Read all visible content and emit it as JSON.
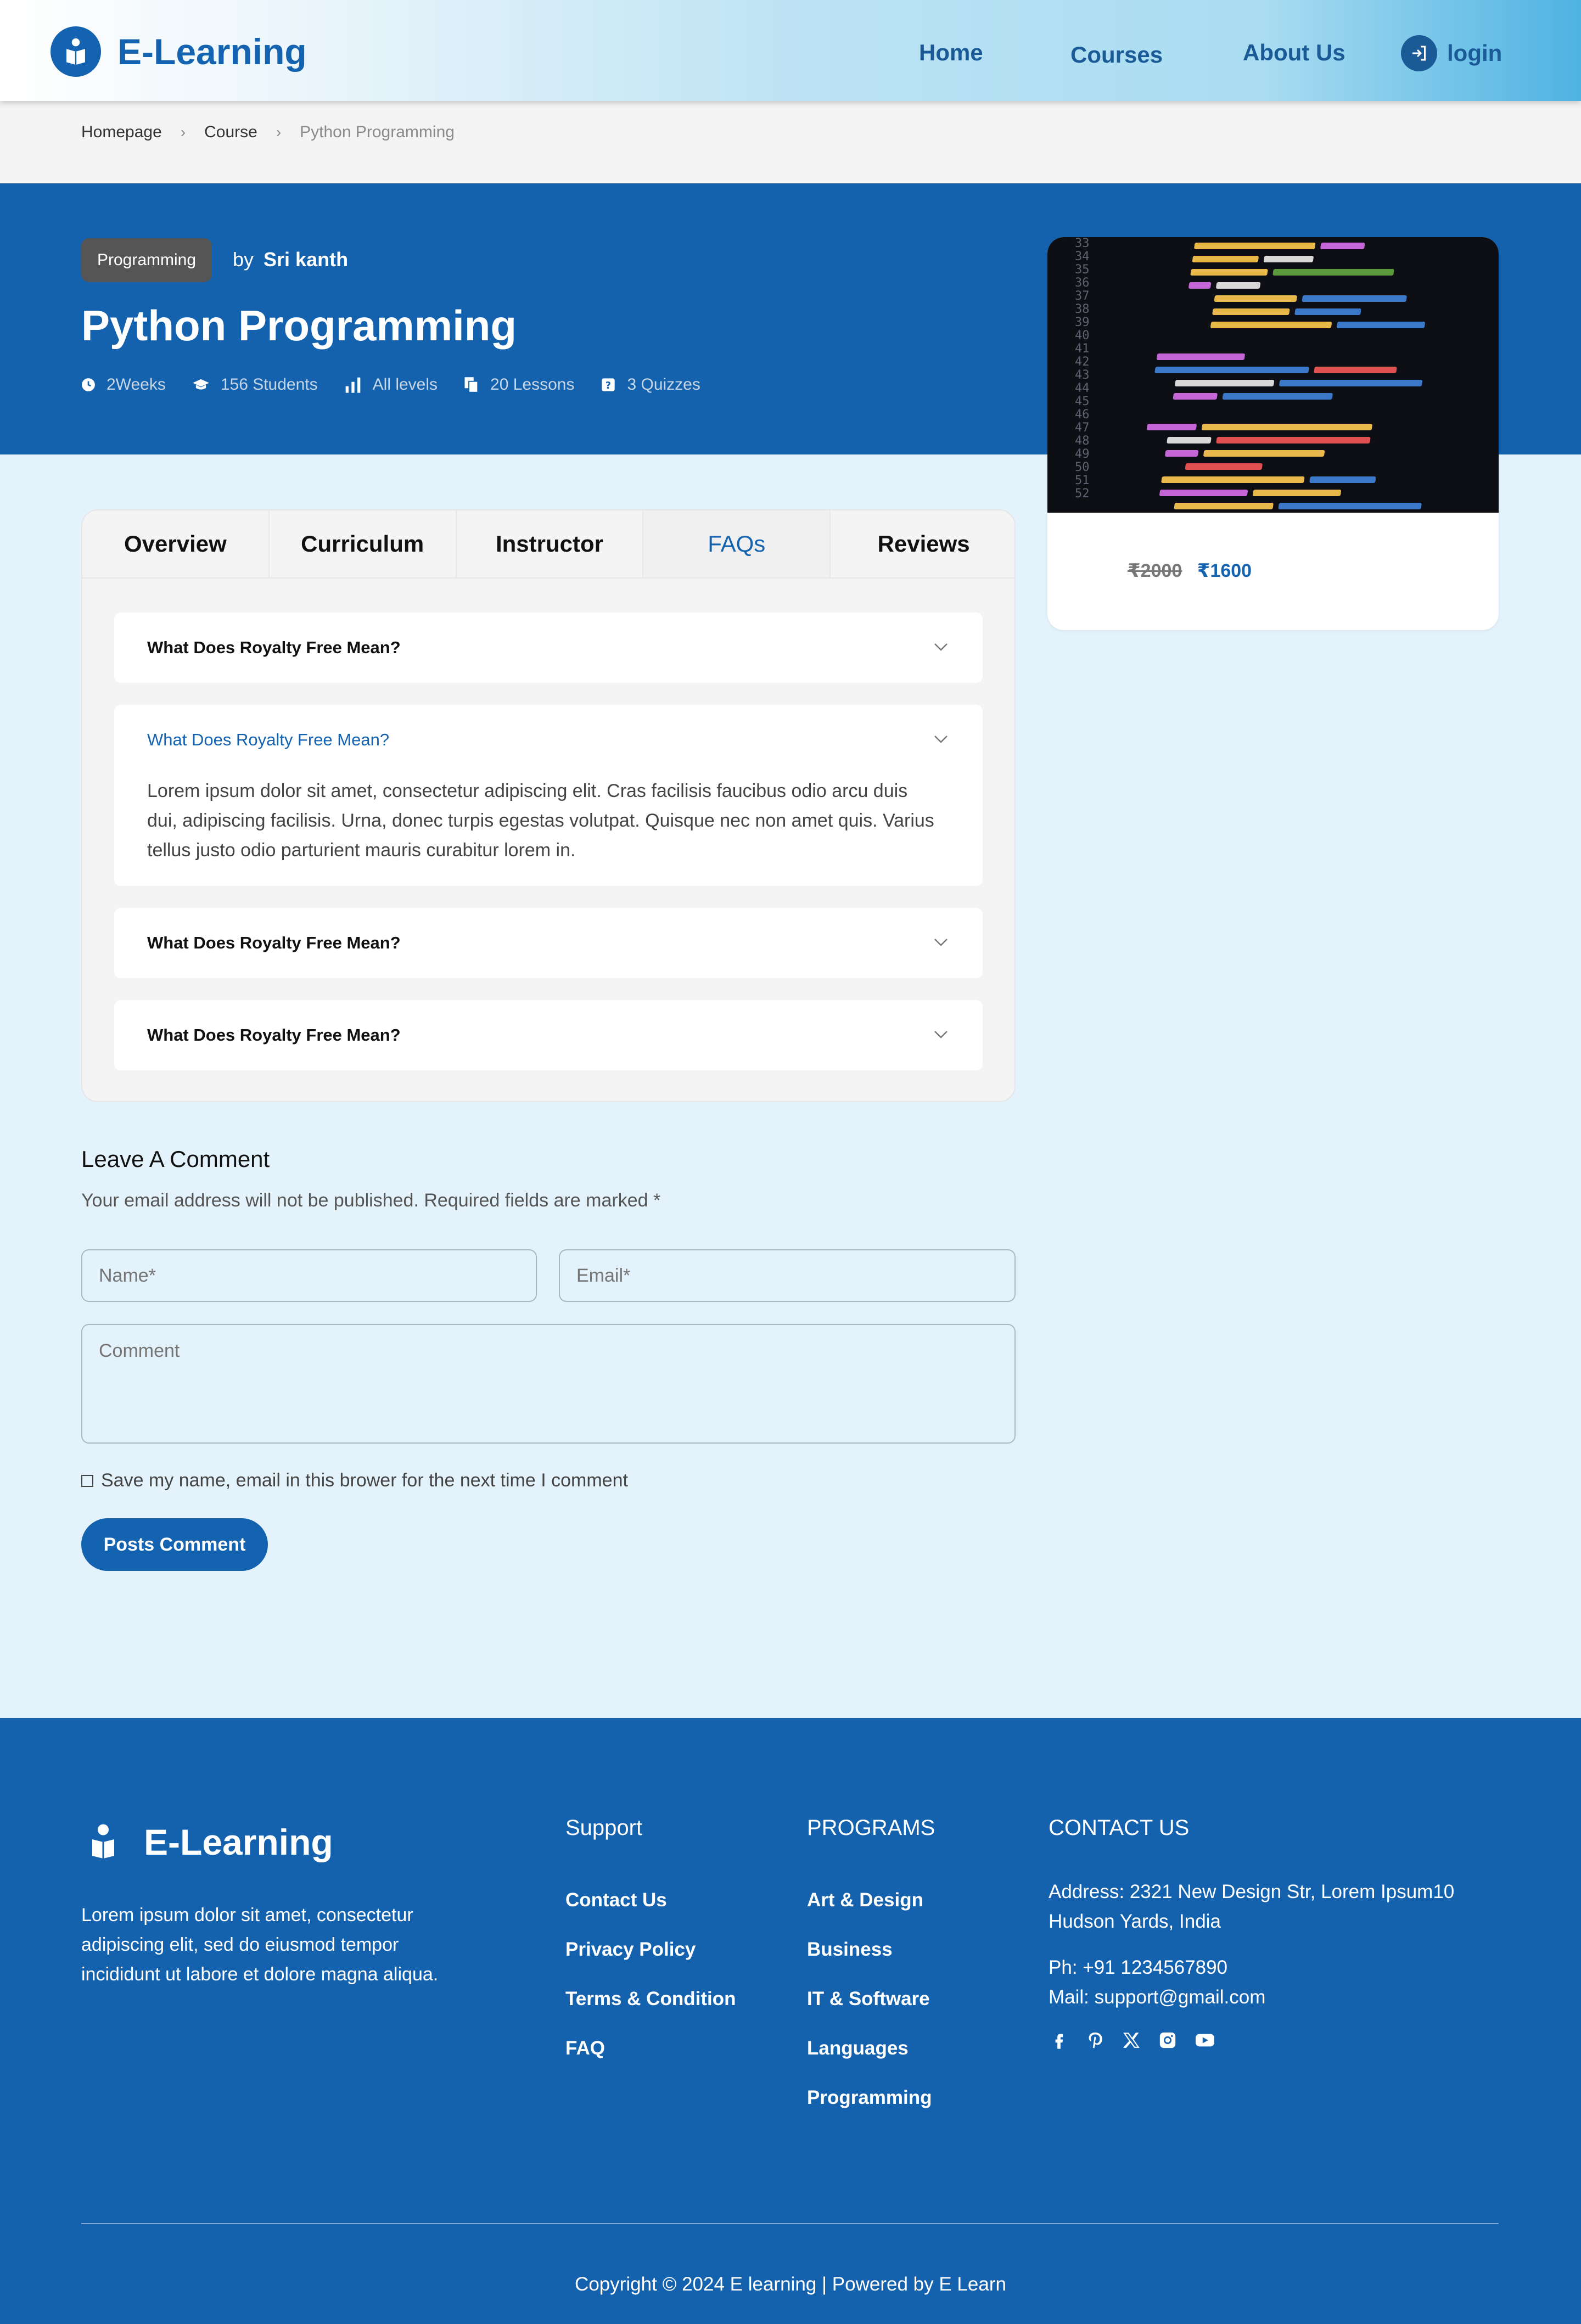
{
  "header": {
    "brand": "E-Learning",
    "nav": [
      "Home",
      "Courses",
      "About Us"
    ],
    "login_label": "login"
  },
  "breadcrumb": [
    "Homepage",
    "Course",
    "Python Programming"
  ],
  "course": {
    "category": "Programming",
    "by_label": "by",
    "author": "Sri kanth",
    "title": "Python Programming",
    "meta": {
      "duration": "2Weeks",
      "students": "156 Students",
      "level": "All levels",
      "lessons": "20 Lessons",
      "quizzes": "3 Quizzes"
    },
    "price_old": "₹2000",
    "price_new": "₹1600"
  },
  "tabs": [
    "Overview",
    "Curriculum",
    "Instructor",
    "FAQs",
    "Reviews"
  ],
  "active_tab": "FAQs",
  "faqs": [
    {
      "q": "What Does Royalty Free Mean?",
      "open": false
    },
    {
      "q": "What Does Royalty Free Mean?",
      "open": true,
      "a": "Lorem ipsum dolor sit amet, consectetur adipiscing elit. Cras facilisis faucibus odio arcu duis dui, adipiscing facilisis. Urna, donec turpis egestas volutpat. Quisque nec non amet quis. Varius tellus justo odio parturient mauris curabitur lorem in."
    },
    {
      "q": "What Does Royalty Free Mean?",
      "open": false
    },
    {
      "q": "What Does Royalty Free Mean?",
      "open": false
    }
  ],
  "comment_form": {
    "title": "Leave A Comment",
    "subtitle": "Your email address will not be published. Required fields are marked *",
    "name_placeholder": "Name*",
    "email_placeholder": "Email*",
    "comment_placeholder": "Comment",
    "save_label": "Save my name, email in this brower for the next time I comment",
    "submit_label": "Posts Comment"
  },
  "footer": {
    "brand": "E-Learning",
    "description": "Lorem ipsum dolor sit amet, consectetur adipiscing elit, sed do eiusmod tempor incididunt ut labore et dolore magna aliqua.",
    "support_heading": "Support",
    "support_links": [
      "Contact Us",
      "Privacy Policy",
      "Terms & Condition",
      "FAQ"
    ],
    "programs_heading": "PROGRAMS",
    "program_links": [
      "Art & Design",
      "Business",
      "IT & Software",
      "Languages",
      "Programming"
    ],
    "contact_heading": "CONTACT US",
    "address": "Address: 2321 New Design Str, Lorem Ipsum10 Hudson Yards, India",
    "phone": "Ph: +91 1234567890",
    "mail": "Mail: support@gmail.com",
    "social_icons": [
      "facebook-icon",
      "pinterest-icon",
      "x-icon",
      "instagram-icon",
      "youtube-icon"
    ],
    "copyright": "Copyright © 2024 E learning | Powered by E Learn"
  },
  "colors": {
    "primary": "#1463b0",
    "page_bg": "#e3f2fb",
    "panel_bg": "#f4f4f4"
  }
}
